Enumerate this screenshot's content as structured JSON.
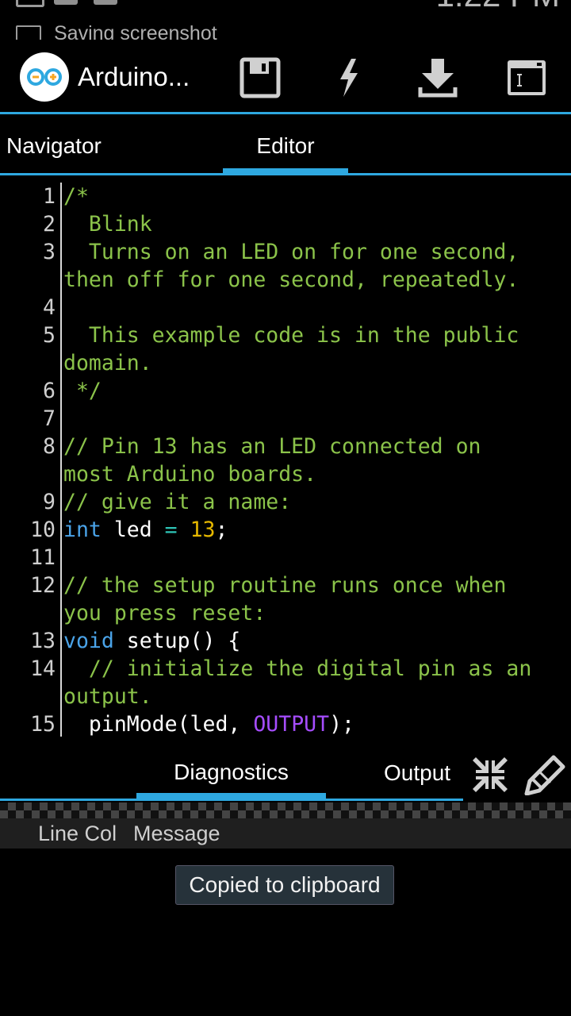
{
  "status_bar": {
    "notification": "Saving screenshot",
    "time": "1:22 PM"
  },
  "action_bar": {
    "app_title": "Arduino...",
    "actions": [
      "save-icon",
      "lightning-icon",
      "download-icon",
      "serial-monitor-icon"
    ],
    "accent_color": "#2ea8e0"
  },
  "tabs": {
    "navigator": "Navigator",
    "editor": "Editor",
    "active": "Editor"
  },
  "editor": {
    "lines": [
      {
        "n": "1",
        "parts": [
          {
            "t": "/*",
            "c": "cm"
          }
        ]
      },
      {
        "n": "2",
        "parts": [
          {
            "t": "  Blink",
            "c": "cm"
          }
        ]
      },
      {
        "n": "3",
        "parts": [
          {
            "t": "  Turns on an LED on for one second,",
            "c": "cm"
          }
        ]
      },
      {
        "n": "",
        "parts": [
          {
            "t": "then off for one second, repeatedly.",
            "c": "cm"
          }
        ]
      },
      {
        "n": "4",
        "parts": [
          {
            "t": "",
            "c": "cm"
          }
        ]
      },
      {
        "n": "5",
        "parts": [
          {
            "t": "  This example code is in the public",
            "c": "cm"
          }
        ]
      },
      {
        "n": "",
        "parts": [
          {
            "t": "domain.",
            "c": "cm"
          }
        ]
      },
      {
        "n": "6",
        "parts": [
          {
            "t": " */",
            "c": "cm"
          }
        ]
      },
      {
        "n": "7",
        "parts": [
          {
            "t": "",
            "c": "cm"
          }
        ]
      },
      {
        "n": "8",
        "parts": [
          {
            "t": "// Pin 13 has an LED connected on",
            "c": "cm"
          }
        ]
      },
      {
        "n": "",
        "parts": [
          {
            "t": "most Arduino boards.",
            "c": "cm"
          }
        ]
      },
      {
        "n": "9",
        "parts": [
          {
            "t": "// give it a name:",
            "c": "cm"
          }
        ]
      },
      {
        "n": "10",
        "parts": [
          {
            "t": "int",
            "c": "kw"
          },
          {
            "t": " led ",
            "c": "pl"
          },
          {
            "t": "=",
            "c": "op"
          },
          {
            "t": " ",
            "c": "pl"
          },
          {
            "t": "13",
            "c": "num"
          },
          {
            "t": ";",
            "c": "pl"
          }
        ]
      },
      {
        "n": "11",
        "parts": [
          {
            "t": "",
            "c": "pl"
          }
        ]
      },
      {
        "n": "12",
        "parts": [
          {
            "t": "// the setup routine runs once when",
            "c": "cm"
          }
        ]
      },
      {
        "n": "",
        "parts": [
          {
            "t": "you press reset:",
            "c": "cm"
          }
        ]
      },
      {
        "n": "13",
        "parts": [
          {
            "t": "void",
            "c": "kw"
          },
          {
            "t": " setup() {",
            "c": "pl"
          }
        ]
      },
      {
        "n": "14",
        "parts": [
          {
            "t": "  // initialize the digital pin as an",
            "c": "cm"
          }
        ]
      },
      {
        "n": "",
        "parts": [
          {
            "t": "output.",
            "c": "cm"
          }
        ]
      },
      {
        "n": "15",
        "parts": [
          {
            "t": "  pinMode(led, ",
            "c": "pl"
          },
          {
            "t": "OUTPUT",
            "c": "cn"
          },
          {
            "t": ");",
            "c": "pl"
          }
        ]
      }
    ]
  },
  "bottom_panel": {
    "diagnostics_tab": "Diagnostics",
    "output_tab": "Output",
    "active": "Diagnostics",
    "header_line_col": "Line Col",
    "header_message": "Message"
  },
  "toast": "Copied to clipboard"
}
